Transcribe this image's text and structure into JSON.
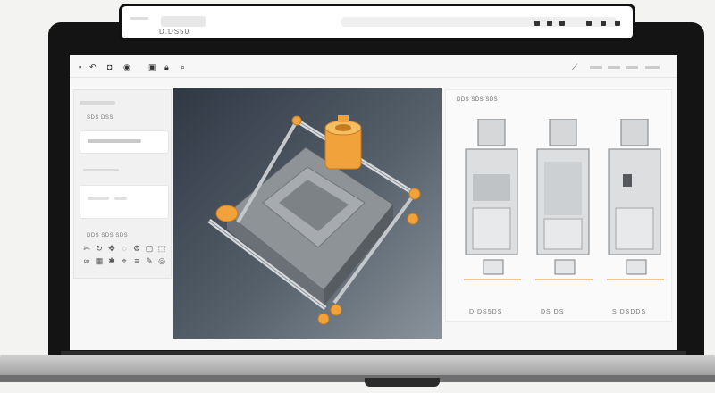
{
  "browser": {
    "tab_title": "D.DS50"
  },
  "app": {
    "viewport_label": "",
    "panel_title": "DDS SDS SDS",
    "left_panel": {
      "section_1_label": "SDS DSS",
      "section_2_label": "DDS SDS SDS"
    },
    "cabinets": [
      {
        "label": "D DS5DS"
      },
      {
        "label": "DS DS"
      },
      {
        "label": "S DSDDS"
      }
    ]
  },
  "colors": {
    "accent": "#f2a23b",
    "viewport_dark": "#303844",
    "dim_line": "#f08a2c"
  }
}
